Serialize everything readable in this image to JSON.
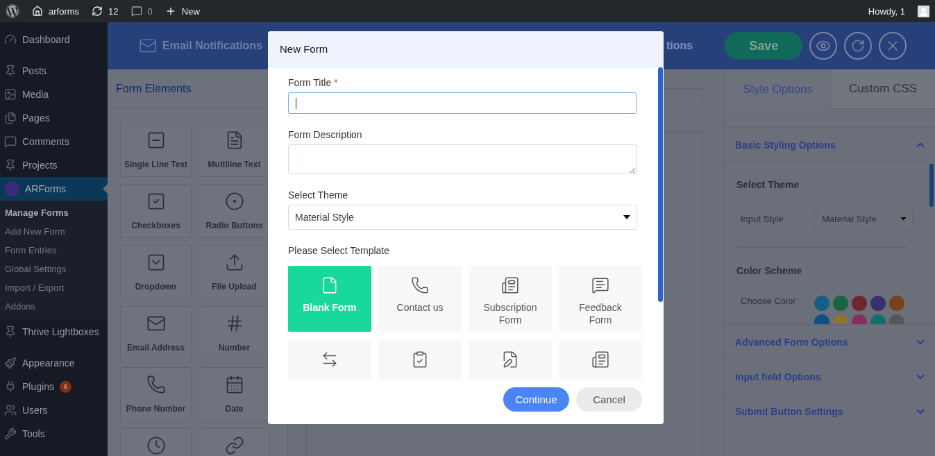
{
  "admin_bar": {
    "items": [
      {
        "kind": "logo"
      },
      {
        "kind": "site",
        "label": "arforms"
      },
      {
        "kind": "updates",
        "label": "12"
      },
      {
        "kind": "comments",
        "label": "0"
      },
      {
        "kind": "new",
        "label": "New"
      }
    ],
    "account": "Howdy, 1"
  },
  "sidebar": {
    "items": [
      {
        "label": "Dashboard",
        "selected": false
      },
      {
        "label": "Posts",
        "selected": false
      },
      {
        "label": "Media",
        "selected": false
      },
      {
        "label": "Pages",
        "selected": false
      },
      {
        "label": "Comments",
        "selected": false
      },
      {
        "label": "Projects",
        "selected": false
      },
      {
        "label": "ARForms",
        "selected": true,
        "children": [
          {
            "label": "Manage Forms",
            "selected": true
          },
          {
            "label": "Add New Form",
            "selected": false
          },
          {
            "label": "Form Entries",
            "selected": false
          },
          {
            "label": "Global Settings",
            "selected": false
          },
          {
            "label": "Import / Export",
            "selected": false
          },
          {
            "label": "Addons",
            "selected": false
          }
        ]
      },
      {
        "label": "Thrive Lightboxes",
        "selected": false
      },
      {
        "label": "Appearance",
        "selected": false
      },
      {
        "label": "Plugins",
        "selected": false,
        "badge": "6"
      },
      {
        "label": "Users",
        "selected": false
      },
      {
        "label": "Tools",
        "selected": false
      }
    ]
  },
  "header": {
    "email_tab": "Email Notifications",
    "cut_tab": "tions",
    "save_button": "Save"
  },
  "form_elements": {
    "title": "Form Elements",
    "items": [
      {
        "label": "Single Line Text"
      },
      {
        "label": "Multiline Text"
      },
      {
        "label": "Checkboxes"
      },
      {
        "label": "Radio Buttons"
      },
      {
        "label": "Dropdown"
      },
      {
        "label": "File Upload"
      },
      {
        "label": "Email Address"
      },
      {
        "label": "Number"
      },
      {
        "label": "Phone Number"
      },
      {
        "label": "Date"
      }
    ]
  },
  "style_panel": {
    "tabs": [
      {
        "label": "Style Options",
        "selected": true
      },
      {
        "label": "Custom CSS",
        "selected": false
      }
    ],
    "sections": [
      {
        "title": "Basic Styling Options",
        "expanded": true
      },
      {
        "title": "Advanced Form Options",
        "expanded": false
      },
      {
        "title": "Input field Options",
        "expanded": false
      },
      {
        "title": "Submit Button Settings",
        "expanded": false
      }
    ],
    "select_theme": "Select Theme",
    "input_style": {
      "label": "Input Style",
      "value": "Material Style"
    },
    "color_scheme": "Color Scheme",
    "choose_color": "Choose Color",
    "colors": [
      {
        "color": "#155f84"
      },
      {
        "color": "#19663e"
      },
      {
        "color": "#6e2633"
      },
      {
        "color": "#34336e"
      },
      {
        "color": "#774217"
      },
      {
        "color": "#0e4f86"
      },
      {
        "color": "#8a7533"
      },
      {
        "color": "#86305f"
      },
      {
        "color": "#0e7070"
      },
      {
        "color": "#55575e"
      }
    ]
  },
  "modal": {
    "title": "New Form",
    "title_label": "Form Title",
    "required": "*",
    "focused": true,
    "description_label": "Form Description",
    "theme_label": "Select Theme",
    "theme_value": "Material Style",
    "template_label": "Please Select Template",
    "templates": [
      {
        "label": "Blank Form",
        "selected": true
      },
      {
        "label": "Contact us",
        "selected": false
      },
      {
        "label": "Subscription Form",
        "selected": false
      },
      {
        "label": "Feedback Form",
        "selected": false
      },
      {
        "selected": false
      },
      {
        "selected": false
      },
      {
        "selected": false
      },
      {
        "selected": false
      }
    ],
    "buttons": [
      {
        "label": "Continue",
        "kind": "primary"
      },
      {
        "label": "Cancel",
        "kind": "secondary"
      }
    ]
  }
}
